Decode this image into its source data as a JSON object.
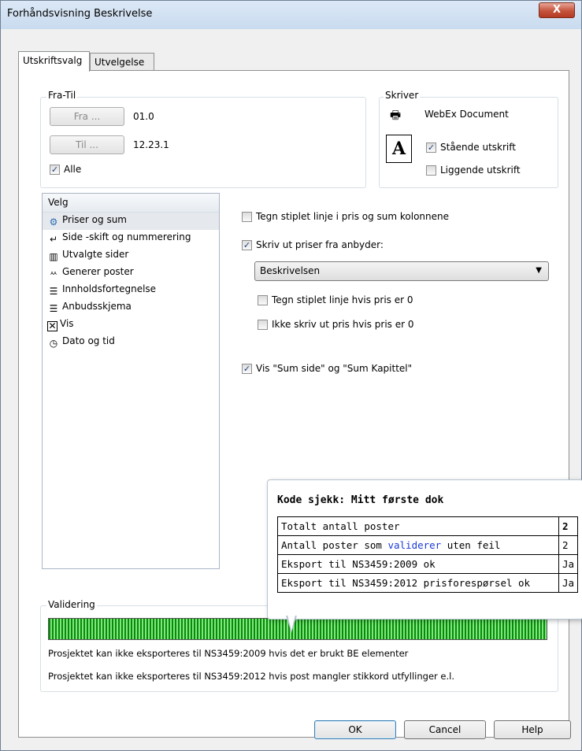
{
  "window": {
    "title": "Forhåndsvisning Beskrivelse",
    "close_glyph": "X"
  },
  "tabs": [
    {
      "label": "Utskriftsvalg",
      "active": true
    },
    {
      "label": "Utvelgelse",
      "active": false
    }
  ],
  "fra_til": {
    "group_label": "Fra-Til",
    "fra_button": "Fra ...",
    "fra_value": "01.0",
    "til_button": "Til ...",
    "til_value": "12.23.1",
    "alle_label": "Alle",
    "alle_checked": true
  },
  "skriver": {
    "group_label": "Skriver",
    "printer_name": "WebEx Document",
    "orientation_icon": "A",
    "staende_label": "Stående utskrift",
    "staende_checked": true,
    "liggende_label": "Liggende utskrift",
    "liggende_checked": false
  },
  "velg": {
    "header": "Velg",
    "items": [
      {
        "label": "Priser og sum",
        "icon": "coins-icon",
        "selected": true
      },
      {
        "label": "Side -skift og nummerering",
        "icon": "page-number-icon",
        "selected": false
      },
      {
        "label": "Utvalgte sider",
        "icon": "pages-icon",
        "selected": false
      },
      {
        "label": "Generer poster",
        "icon": "generate-icon",
        "selected": false
      },
      {
        "label": "Innholdsfortegnelse",
        "icon": "toc-icon",
        "selected": false
      },
      {
        "label": "Anbudsskjema",
        "icon": "form-icon",
        "selected": false
      },
      {
        "label": "Vis",
        "icon": "x-box-icon",
        "selected": false
      },
      {
        "label": "Dato og tid",
        "icon": "clock-icon",
        "selected": false
      }
    ]
  },
  "options": {
    "tegn_stiplet_sum": {
      "label": "Tegn stiplet linje i pris og sum kolonnene",
      "checked": false
    },
    "skriv_ut_priser": {
      "label": "Skriv ut priser fra anbyder:",
      "checked": true
    },
    "anbyder_select": "Beskrivelsen",
    "tegn_stiplet_0": {
      "label": "Tegn stiplet linje hvis pris er 0",
      "checked": false
    },
    "ikke_skriv_0": {
      "label": "Ikke skriv ut pris hvis pris er 0",
      "checked": false
    },
    "vis_sum": {
      "label": "Vis \"Sum side\" og \"Sum Kapittel\"",
      "checked": true
    }
  },
  "validering": {
    "group_label": "Validering",
    "progress": 1.0,
    "message1": "Prosjektet kan ikke eksporteres til NS3459:2009 hvis det er brukt BE elementer",
    "message2": "Prosjektet kan ikke eksporteres til NS3459:2012 hvis post mangler stikkord utfyllinger e.l."
  },
  "tooltip": {
    "title": "Kode sjekk: Mitt første dok",
    "rows": [
      {
        "label": "Totalt antall poster",
        "value": "2"
      },
      {
        "label_pre": "Antall poster som ",
        "label_link": "validerer",
        "label_post": " uten feil",
        "value": "2"
      },
      {
        "label": "Eksport til NS3459:2009 ok",
        "value": "Ja"
      },
      {
        "label": "Eksport til NS3459:2012 prisforespørsel ok",
        "value": "Ja"
      }
    ]
  },
  "buttons": {
    "ok": "OK",
    "cancel": "Cancel",
    "help": "Help"
  },
  "colors": {
    "progress_green": "#0a8a0a",
    "close_red": "#c4533c",
    "link_blue": "#1a3bd6"
  }
}
